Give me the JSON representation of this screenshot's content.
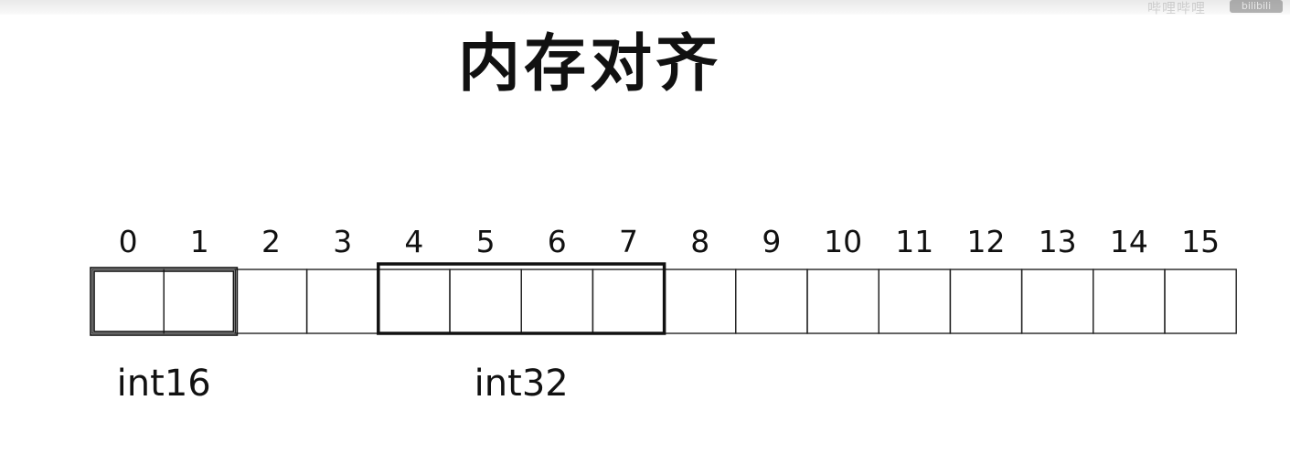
{
  "window": {
    "watermark": "哔哩哔哩",
    "logo_text": "bilibili"
  },
  "title": "内存对齐",
  "memory": {
    "indices": [
      "0",
      "1",
      "2",
      "3",
      "4",
      "5",
      "6",
      "7",
      "8",
      "9",
      "10",
      "11",
      "12",
      "13",
      "14",
      "15"
    ],
    "cell_count": 16,
    "groups": [
      {
        "label": "int16",
        "start": 0,
        "end": 1,
        "style": "double"
      },
      {
        "label": "int32",
        "start": 4,
        "end": 7,
        "style": "bold"
      }
    ]
  }
}
